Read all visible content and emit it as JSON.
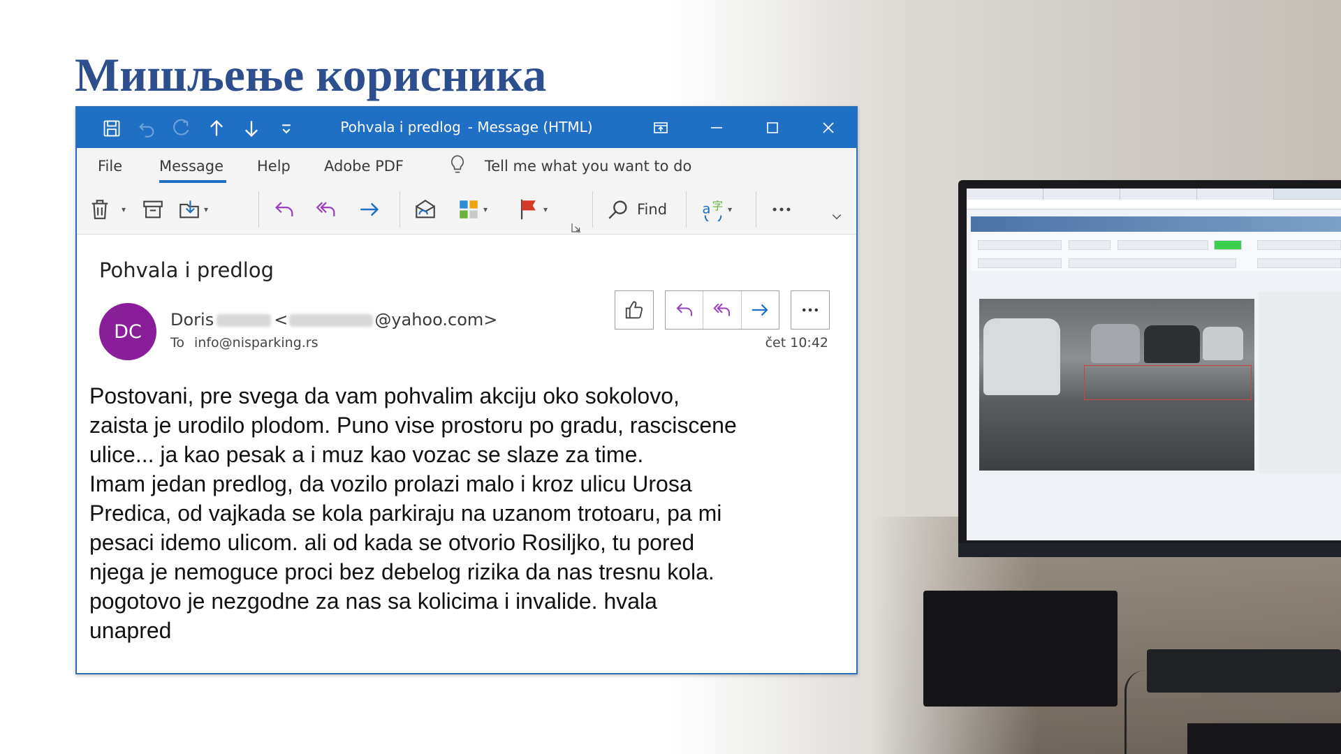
{
  "slide": {
    "title": "Мишљење корисника"
  },
  "window": {
    "title": "Pohvala i predlog",
    "title_suffix": "-  Message (HTML)",
    "quick_access": [
      "save-icon",
      "undo-icon",
      "redo-icon",
      "arrow-up-icon",
      "arrow-down-icon",
      "customize-icon"
    ],
    "controls": [
      "ribbon-display-icon",
      "minimize-icon",
      "maximize-icon",
      "close-icon"
    ]
  },
  "menu": {
    "tabs": [
      "File",
      "Message",
      "Help",
      "Adobe PDF"
    ],
    "active_tab": "Message",
    "tell_me": "Tell me what you want to do"
  },
  "ribbon": {
    "find_label": "Find",
    "buttons": [
      "delete-icon",
      "archive-icon",
      "move-icon",
      "reply-icon",
      "reply-all-icon",
      "forward-icon",
      "read-unread-icon",
      "categorize-icon",
      "flag-icon",
      "find-icon",
      "translate-icon",
      "more-icon"
    ]
  },
  "message": {
    "subject": "Pohvala i predlog",
    "avatar_initials": "DC",
    "sender_first": "Doris",
    "sender_open": "<",
    "sender_domain": "@yahoo.com>",
    "to_label": "To",
    "to_address": "info@nisparking.rs",
    "time": "čet 10:42",
    "body_lines": [
      "Postovani, pre svega da vam pohvalim akciju oko sokolovo,",
      "zaista je urodilo plodom. Puno vise prostoru po gradu, rasciscene",
      "ulice... ja kao pesak a i muz kao vozac se slaze za time.",
      "Imam jedan predlog, da vozilo prolazi malo i kroz ulicu Urosa",
      "Predica, od vajkada se kola parkiraju na uzanom trotoaru, pa mi",
      "pesaci idemo ulicom. ali od kada se otvorio Rosiljko, tu pored",
      "njega je nemoguce proci  bez debelog rizika da nas tresnu kola.",
      "pogotovo je nezgodne za nas sa kolicima i invalide. hvala",
      "unapred"
    ]
  },
  "colors": {
    "title_blue": "#2e4f8e",
    "titlebar_blue": "#1f6fc5",
    "avatar_purple": "#8a1d99",
    "accent_purple": "#9b3fc0",
    "accent_blue": "#1f6fc5",
    "flag_red": "#d43a2a"
  }
}
